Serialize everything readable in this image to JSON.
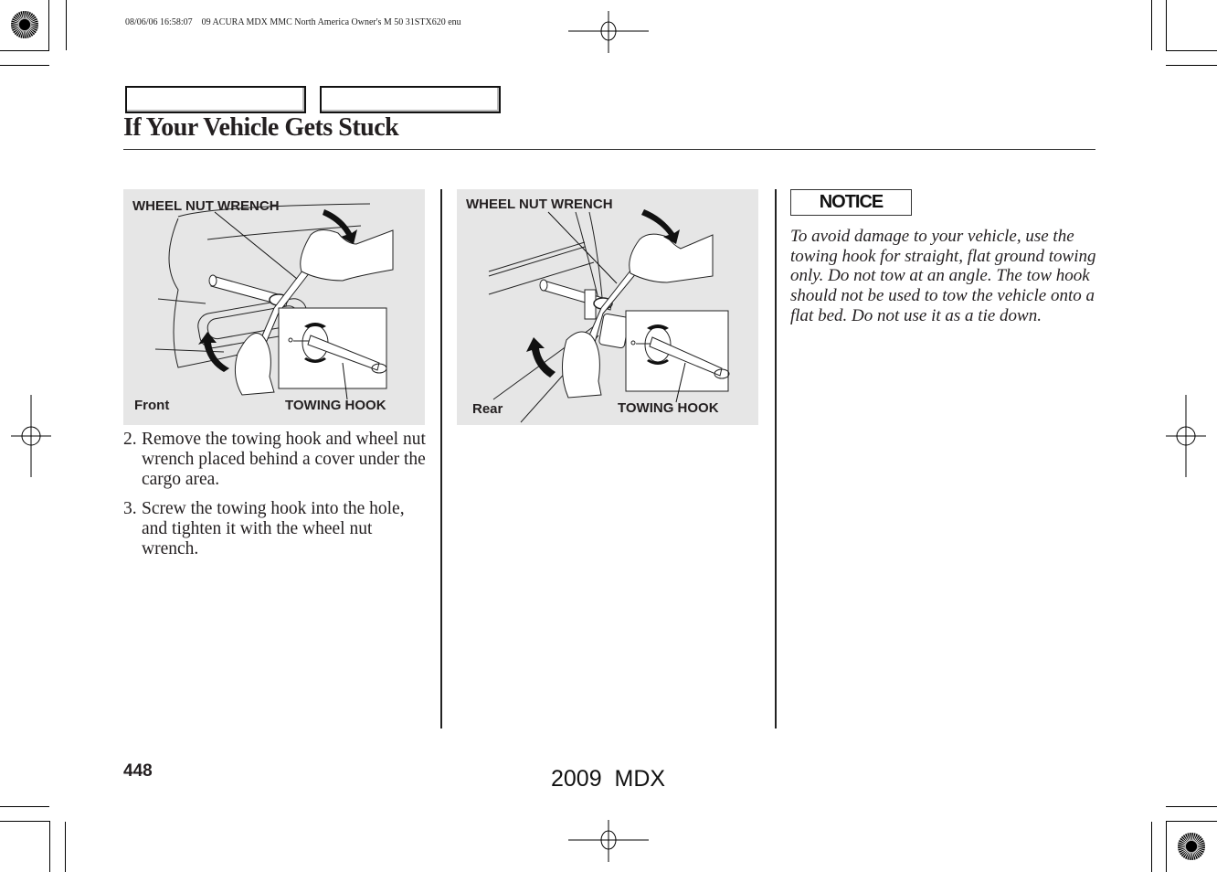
{
  "print_slug": "08/06/06 16:58:07    09 ACURA MDX MMC North America Owner's M 50 31STX620 enu",
  "header": {
    "tabs": [
      "",
      ""
    ],
    "title": "If Your Vehicle Gets Stuck"
  },
  "figures": [
    {
      "view": "Front",
      "label_top": "WHEEL NUT WRENCH",
      "label_bottom": "TOWING HOOK"
    },
    {
      "view": "Rear",
      "label_top": "WHEEL NUT WRENCH",
      "label_bottom": "TOWING HOOK"
    }
  ],
  "steps": [
    {
      "num": "2.",
      "text": "Remove the towing hook and wheel nut wrench placed behind a cover under the cargo area."
    },
    {
      "num": "3.",
      "text": "Screw the towing hook into the hole, and tighten it with the wheel nut wrench."
    }
  ],
  "notice": {
    "label": "NOTICE",
    "text": "To avoid damage to your vehicle, use the towing hook for straight, flat ground towing only. Do not tow at an angle. The tow hook should not be used to tow the vehicle onto a flat bed. Do not use it as a tie down."
  },
  "footer": {
    "page_number": "448",
    "model": "2009  MDX"
  },
  "icons": {
    "registration": "registration-target-icon",
    "starburst": "starburst-target-icon"
  }
}
